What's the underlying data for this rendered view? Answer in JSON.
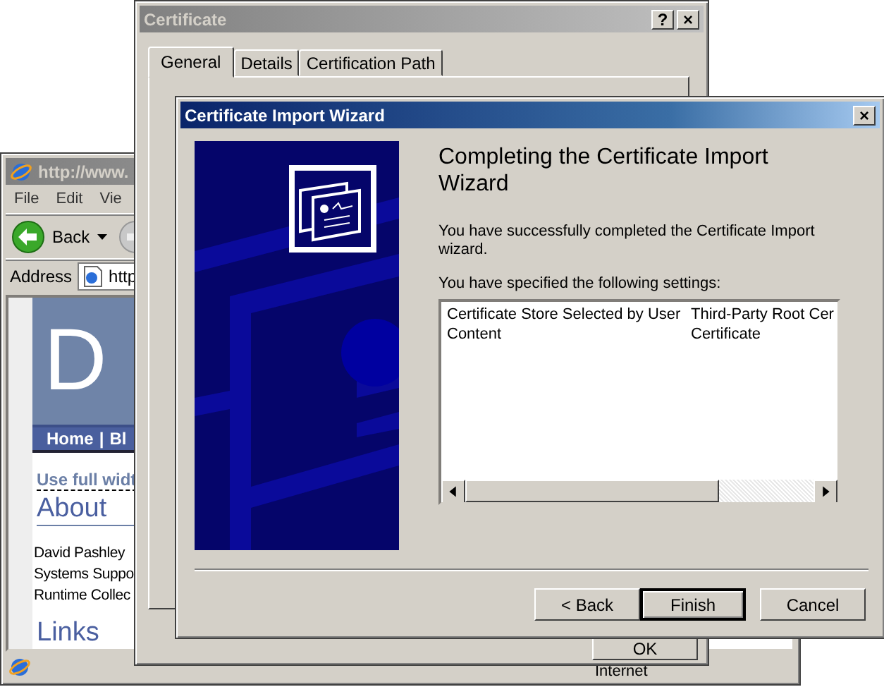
{
  "browser": {
    "title": "http://www.",
    "active": false,
    "menu": [
      "File",
      "Edit",
      "Vie"
    ],
    "back_label": "Back",
    "address_label": "Address",
    "address_value": "http",
    "site": {
      "logo": "D",
      "nav": [
        "Home",
        "Bl"
      ],
      "nav_separator": "|",
      "full_width_link": "Use full widt",
      "about_heading": "About",
      "about_lines": [
        "David Pashley",
        "Systems Suppo",
        "Runtime Collec"
      ],
      "links_heading": "Links"
    },
    "status_zone": "Internet"
  },
  "certificate": {
    "title": "Certificate",
    "active": false,
    "title_buttons": [
      "?",
      "×"
    ],
    "tabs": [
      {
        "label": "General",
        "selected": true
      },
      {
        "label": "Details",
        "selected": false
      },
      {
        "label": "Certification Path",
        "selected": false
      }
    ],
    "ok_button": "OK"
  },
  "wizard": {
    "title": "Certificate Import Wizard",
    "active": true,
    "close": "×",
    "heading": "Completing the Certificate Import Wizard",
    "message": "You have successfully completed the Certificate Import wizard.",
    "settings_label": "You have specified the following settings:",
    "settings": [
      {
        "field": "Certificate Store Selected by User",
        "value": "Third-Party Root Cer"
      },
      {
        "field": "Content",
        "value": "Certificate"
      }
    ],
    "buttons": [
      {
        "label": "< Back",
        "default": false
      },
      {
        "label": "Finish",
        "default": true
      },
      {
        "label": "Cancel",
        "default": false
      }
    ]
  }
}
